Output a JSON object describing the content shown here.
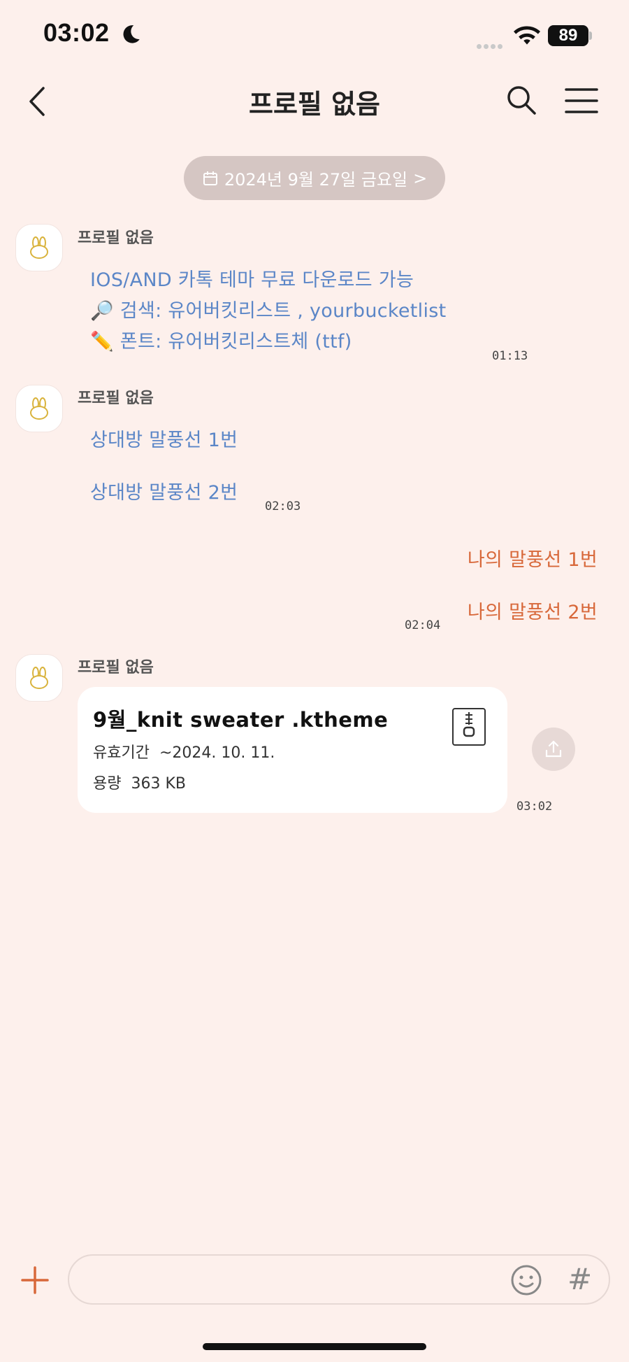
{
  "status_bar": {
    "time": "03:02",
    "battery": "89"
  },
  "header": {
    "title": "프로필 없음"
  },
  "date_divider": {
    "label": "2024년 9월 27일 금요일",
    "chevron": ">"
  },
  "messages": [
    {
      "sender": "프로필 없음",
      "lines": [
        "IOS/AND 카톡 테마 무료 다운로드 가능",
        "🔎 검색: 유어버킷리스트 , yourbucketlist",
        "✏️ 폰트: 유어버킷리스트체 (ttf)"
      ],
      "time": "01:13"
    },
    {
      "sender": "프로필 없음",
      "lines": [
        "상대방 말풍선 1번",
        "상대방 말풍선 2번"
      ],
      "time": "02:03"
    },
    {
      "sender": "me",
      "lines": [
        "나의 말풍선 1번",
        "나의 말풍선 2번"
      ],
      "time": "02:04"
    },
    {
      "sender": "프로필 없음",
      "file": {
        "name": "9월_knit sweater .ktheme",
        "expiry_label": "유효기간",
        "expiry_value": "~2024. 10. 11.",
        "size_label": "용량",
        "size_value": "363 KB"
      },
      "time": "03:02"
    }
  ],
  "input": {
    "placeholder": "",
    "value": ""
  },
  "icons": {
    "back": "chevron-left-icon",
    "search": "search-icon",
    "menu": "menu-icon",
    "calendar": "calendar-icon",
    "avatar": "bunny-icon",
    "zip": "zip-file-icon",
    "share": "share-icon",
    "plus": "plus-icon",
    "emoji": "emoji-icon",
    "hash": "#"
  },
  "colors": {
    "background": "#fdf0ec",
    "partner_text": "#5b86c7",
    "my_text": "#d8683a",
    "date_pill": "#d5c6c3"
  }
}
